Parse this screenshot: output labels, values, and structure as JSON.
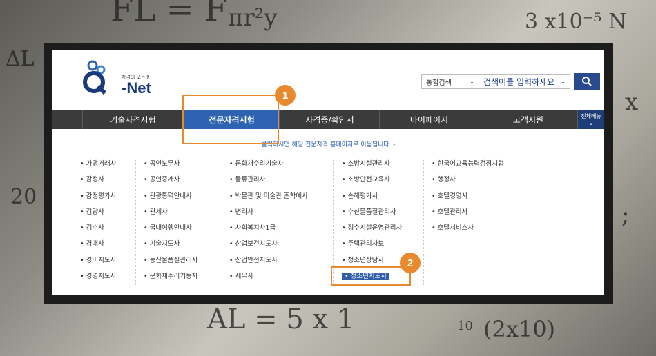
{
  "logo": {
    "tagline": "자격의 모든것",
    "name": "-Net"
  },
  "search": {
    "category": "통합검색",
    "placeholder": "검색어를 입력하세요"
  },
  "nav": {
    "items": [
      "기술자격시험",
      "전문자격시험",
      "자격증/확인서",
      "마이페이지",
      "고객지원"
    ],
    "all_menu": "전체메뉴"
  },
  "notice": "클릭하시면 해당 전문자격 홈페이지로 이동됩니다. -",
  "columns": [
    [
      "가맹거래사",
      "감정사",
      "감정평가사",
      "검량사",
      "검수사",
      "경매사",
      "경비지도사",
      "경영지도사"
    ],
    [
      "공인노무사",
      "공인중개사",
      "관광통역안내사",
      "관세사",
      "국내여행안내사",
      "기술지도사",
      "농산물품질관리사",
      "문화재수리기능자"
    ],
    [
      "문화재수리기술자",
      "물류관리사",
      "박물관 및 미술관 준학예사",
      "변리사",
      "사회복지사1급",
      "산업보건지도사",
      "산업안전지도사",
      "세무사"
    ],
    [
      "소방시설관리사",
      "소방안전교육사",
      "손해평가사",
      "수산물품질관리사",
      "정수시설운영관리사",
      "주택관리사보",
      "청소년상담사",
      "청소년지도사"
    ],
    [
      "한국어교육능력검정시험",
      "행정사",
      "호텔경영사",
      "호텔관리사",
      "호텔서비스사"
    ]
  ],
  "callouts": [
    "1",
    "2"
  ],
  "background_text": {
    "formula_top": "FL = F",
    "formula_frac": "πr²y",
    "formula_right": "3 x10⁻⁵ N",
    "left1": "ΔL",
    "left2": "20",
    "bottom1": "AL = 5 x 1",
    "bottom2": "(2x10)",
    "bottom_exp": "10",
    "right_x": "x",
    "right_semicolon": ";"
  },
  "colors": {
    "accent": "#e8892e",
    "nav_active": "#2d63b0",
    "nav_bg": "#3b3b3b",
    "link_blue": "#2a5cb0"
  }
}
